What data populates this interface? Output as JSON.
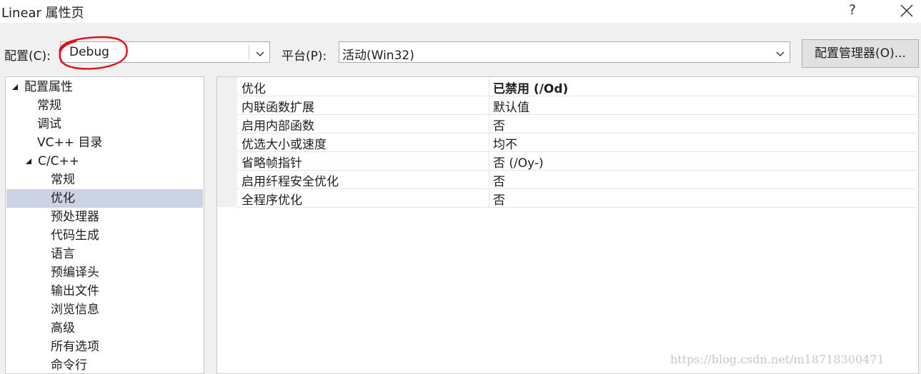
{
  "window": {
    "title": "Linear 属性页",
    "help": "?",
    "close_icon": "close-icon"
  },
  "toolbar": {
    "config_label": "配置(C):",
    "config_value": "Debug",
    "platform_label": "平台(P):",
    "platform_value": "活动(Win32)",
    "manager_button": "配置管理器(O)..."
  },
  "tree": {
    "items": [
      {
        "label": "配置属性",
        "expanded": true
      },
      {
        "label": "常规"
      },
      {
        "label": "调试"
      },
      {
        "label": "VC++ 目录"
      },
      {
        "label": "C/C++",
        "expanded": true
      },
      {
        "label": "常规"
      },
      {
        "label": "优化",
        "selected": true
      },
      {
        "label": "预处理器"
      },
      {
        "label": "代码生成"
      },
      {
        "label": "语言"
      },
      {
        "label": "预编译头"
      },
      {
        "label": "输出文件"
      },
      {
        "label": "浏览信息"
      },
      {
        "label": "高级"
      },
      {
        "label": "所有选项"
      },
      {
        "label": "命令行"
      }
    ]
  },
  "properties": [
    {
      "name": "优化",
      "value": "已禁用 (/Od)"
    },
    {
      "name": "内联函数扩展",
      "value": "默认值"
    },
    {
      "name": "启用内部函数",
      "value": "否"
    },
    {
      "name": "优选大小或速度",
      "value": "均不"
    },
    {
      "name": "省略帧指针",
      "value": "否 (/Oy-)"
    },
    {
      "name": "启用纤程安全优化",
      "value": "否"
    },
    {
      "name": "全程序优化",
      "value": "否"
    }
  ],
  "watermark": "https://blog.csdn.net/m18718300471",
  "colors": {
    "selection": "#ccd4e4",
    "annotation": "#e0101a"
  }
}
